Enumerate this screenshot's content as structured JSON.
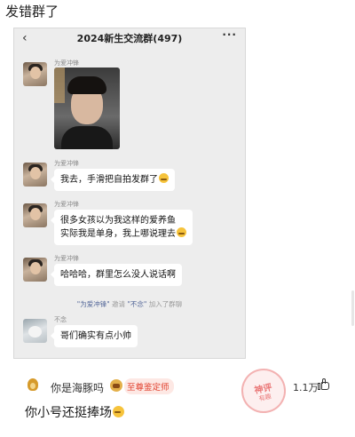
{
  "post": {
    "title": "发错群了"
  },
  "chat": {
    "header": {
      "back_icon": "chevron-left-icon",
      "title": "2024新生交流群(497)",
      "more_icon": "more-dots-icon"
    },
    "messages": [
      {
        "sender": "为爱冲锋",
        "type": "image"
      },
      {
        "sender": "为爱冲锋",
        "text": "我去，手滑把自拍发群了"
      },
      {
        "sender": "为爱冲锋",
        "lines": [
          "很多女孩以为我这样的爱养鱼",
          "实际我是单身，我上哪说理去"
        ]
      },
      {
        "sender": "为爱冲锋",
        "text": "哈哈哈，群里怎么没人说话啊"
      },
      {
        "sender": "不念",
        "text": "哥们确实有点小帅"
      }
    ],
    "system_note": {
      "inviter": "\"为爱冲锋\"",
      "mid": "邀请",
      "invitee": "\"不念\"",
      "end": "加入了群聊"
    }
  },
  "comment": {
    "username": "你是海豚吗",
    "badge": "至尊鉴定师",
    "text": "你小号还挺捧场",
    "likes": "1.1万",
    "stamp": {
      "line1": "神评",
      "line2": "有趣"
    }
  },
  "colors": {
    "chat_bg": "#ededed",
    "bubble": "#ffffff",
    "badge_red": "#e1412e"
  }
}
